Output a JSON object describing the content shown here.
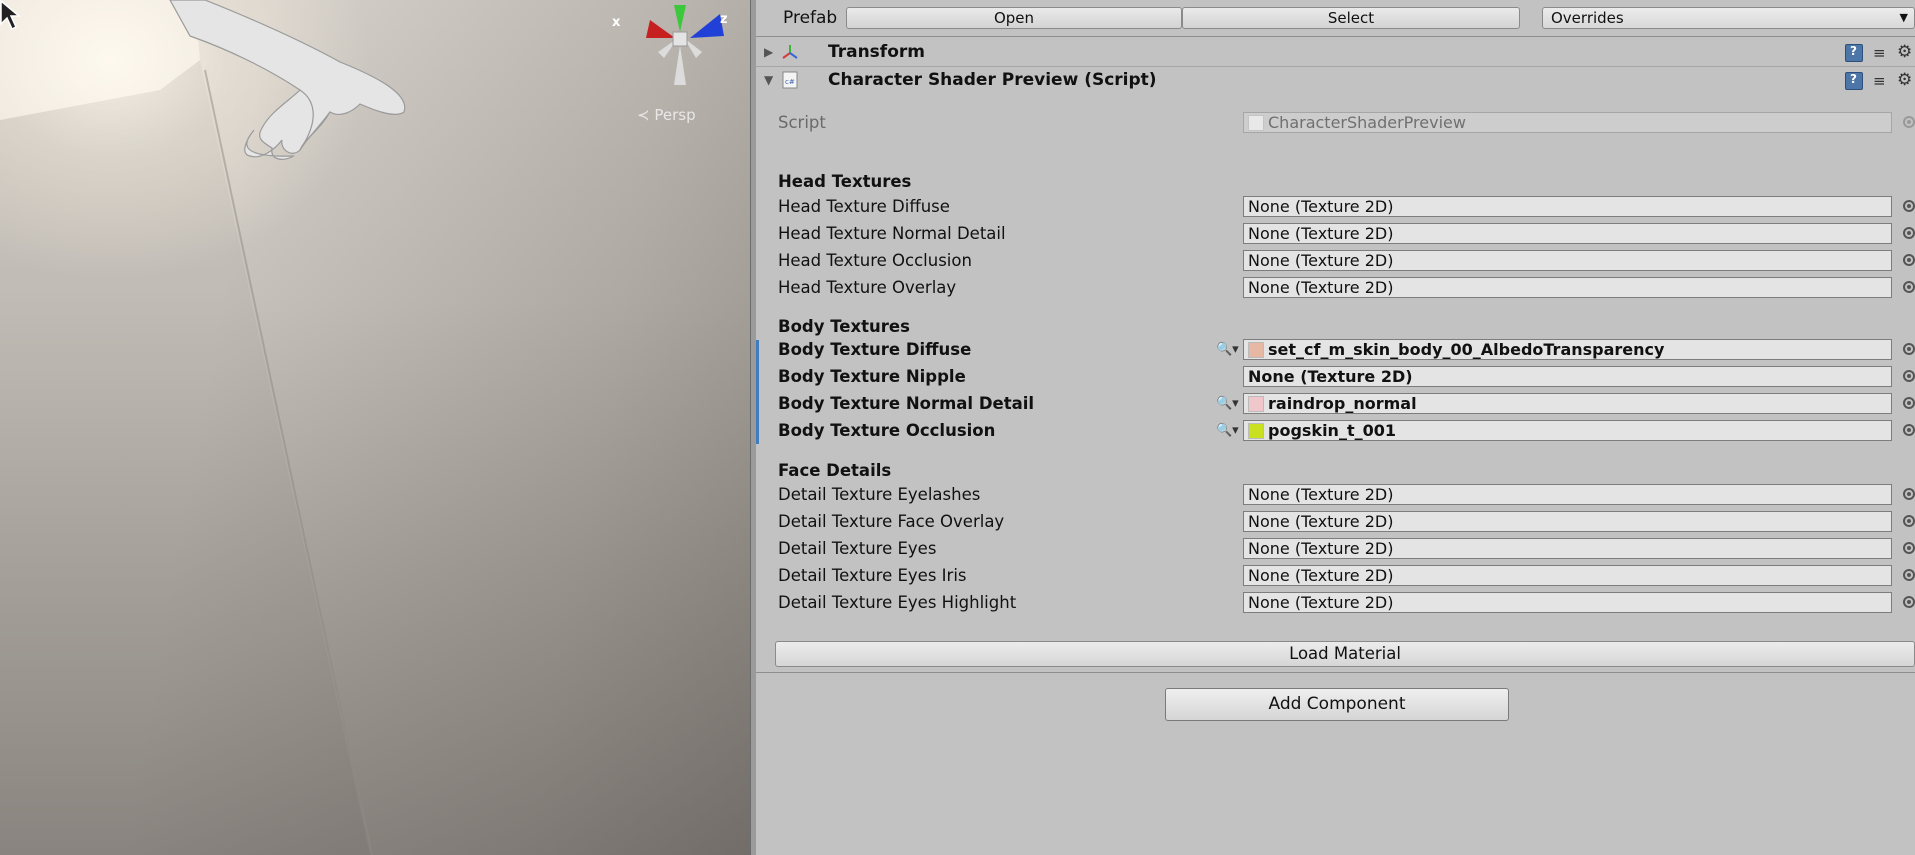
{
  "scene": {
    "projection_label": "Persp",
    "gizmo": {
      "x_label": "x",
      "z_label": "z"
    }
  },
  "inspector": {
    "prefab": {
      "label": "Prefab",
      "open_label": "Open",
      "select_label": "Select",
      "overrides_label": "Overrides"
    },
    "components": [
      {
        "title": "Transform"
      },
      {
        "title": "Character Shader Preview (Script)"
      }
    ],
    "script_field": {
      "label": "Script",
      "value": "CharacterShaderPreview"
    },
    "head_section": {
      "title": "Head Textures",
      "fields": [
        {
          "label": "Head Texture Diffuse",
          "value": "None (Texture 2D)"
        },
        {
          "label": "Head Texture Normal Detail",
          "value": "None (Texture 2D)"
        },
        {
          "label": "Head Texture Occlusion",
          "value": "None (Texture 2D)"
        },
        {
          "label": "Head Texture Overlay",
          "value": "None (Texture 2D)"
        }
      ]
    },
    "body_section": {
      "title": "Body Textures",
      "fields": [
        {
          "label": "Body Texture Diffuse",
          "value": "set_cf_m_skin_body_00_AlbedoTransparency",
          "thumb_color": "#e6b8a4"
        },
        {
          "label": "Body Texture Nipple",
          "value": "None (Texture 2D)"
        },
        {
          "label": "Body Texture Normal Detail",
          "value": "raindrop_normal",
          "thumb_color": "#f0c8cc"
        },
        {
          "label": "Body Texture Occlusion",
          "value": "pogskin_t_001",
          "thumb_color": "#c8e020"
        }
      ]
    },
    "face_section": {
      "title": "Face Details",
      "fields": [
        {
          "label": "Detail Texture Eyelashes",
          "value": "None (Texture 2D)"
        },
        {
          "label": "Detail Texture Face Overlay",
          "value": "None (Texture 2D)"
        },
        {
          "label": "Detail Texture Eyes",
          "value": "None (Texture 2D)"
        },
        {
          "label": "Detail Texture Eyes Iris",
          "value": "None (Texture 2D)"
        },
        {
          "label": "Detail Texture Eyes Highlight",
          "value": "None (Texture 2D)"
        }
      ]
    },
    "load_material_label": "Load Material",
    "add_component_label": "Add Component"
  },
  "colors": {
    "inspector_bg": "#c2c2c2",
    "override_bar": "#3f7dbd",
    "field_bg": "#e4e4e4"
  }
}
